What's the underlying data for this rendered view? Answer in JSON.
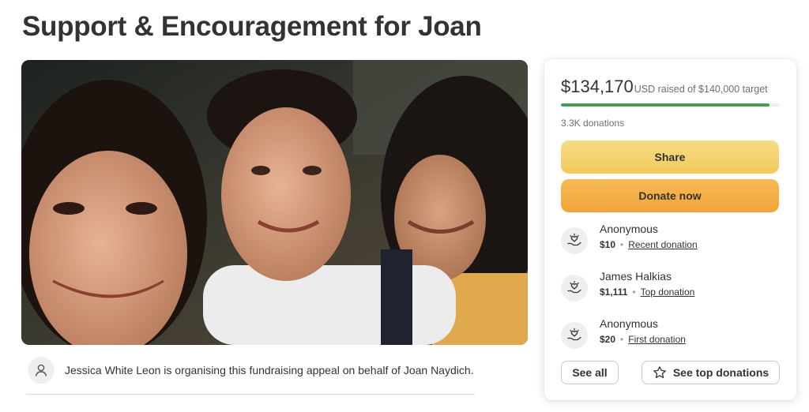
{
  "page": {
    "title": "Support & Encouragement for Joan"
  },
  "hero": {
    "image_name": "three-people-selfie-photo"
  },
  "organiser": {
    "text": "Jessica White Leon is organising this fundraising appeal on behalf of Joan Naydich."
  },
  "summary": {
    "raised_amount": "$134,170",
    "raised_suffix": "USD raised of $140,000 target",
    "progress_fraction": 0.958,
    "donations_count": "3.3K donations",
    "share_label": "Share",
    "donate_label": "Donate now"
  },
  "donations": [
    {
      "name": "Anonymous",
      "amount": "$10",
      "tag": "Recent donation"
    },
    {
      "name": "James Halkias",
      "amount": "$1,111",
      "tag": "Top donation"
    },
    {
      "name": "Anonymous",
      "amount": "$20",
      "tag": "First donation"
    }
  ],
  "actions": {
    "see_all_label": "See all",
    "see_top_label": "See top donations"
  },
  "colors": {
    "progress_fill": "#3fa056",
    "share_button": "#f2ca5c",
    "donate_button": "#f0a43a"
  }
}
